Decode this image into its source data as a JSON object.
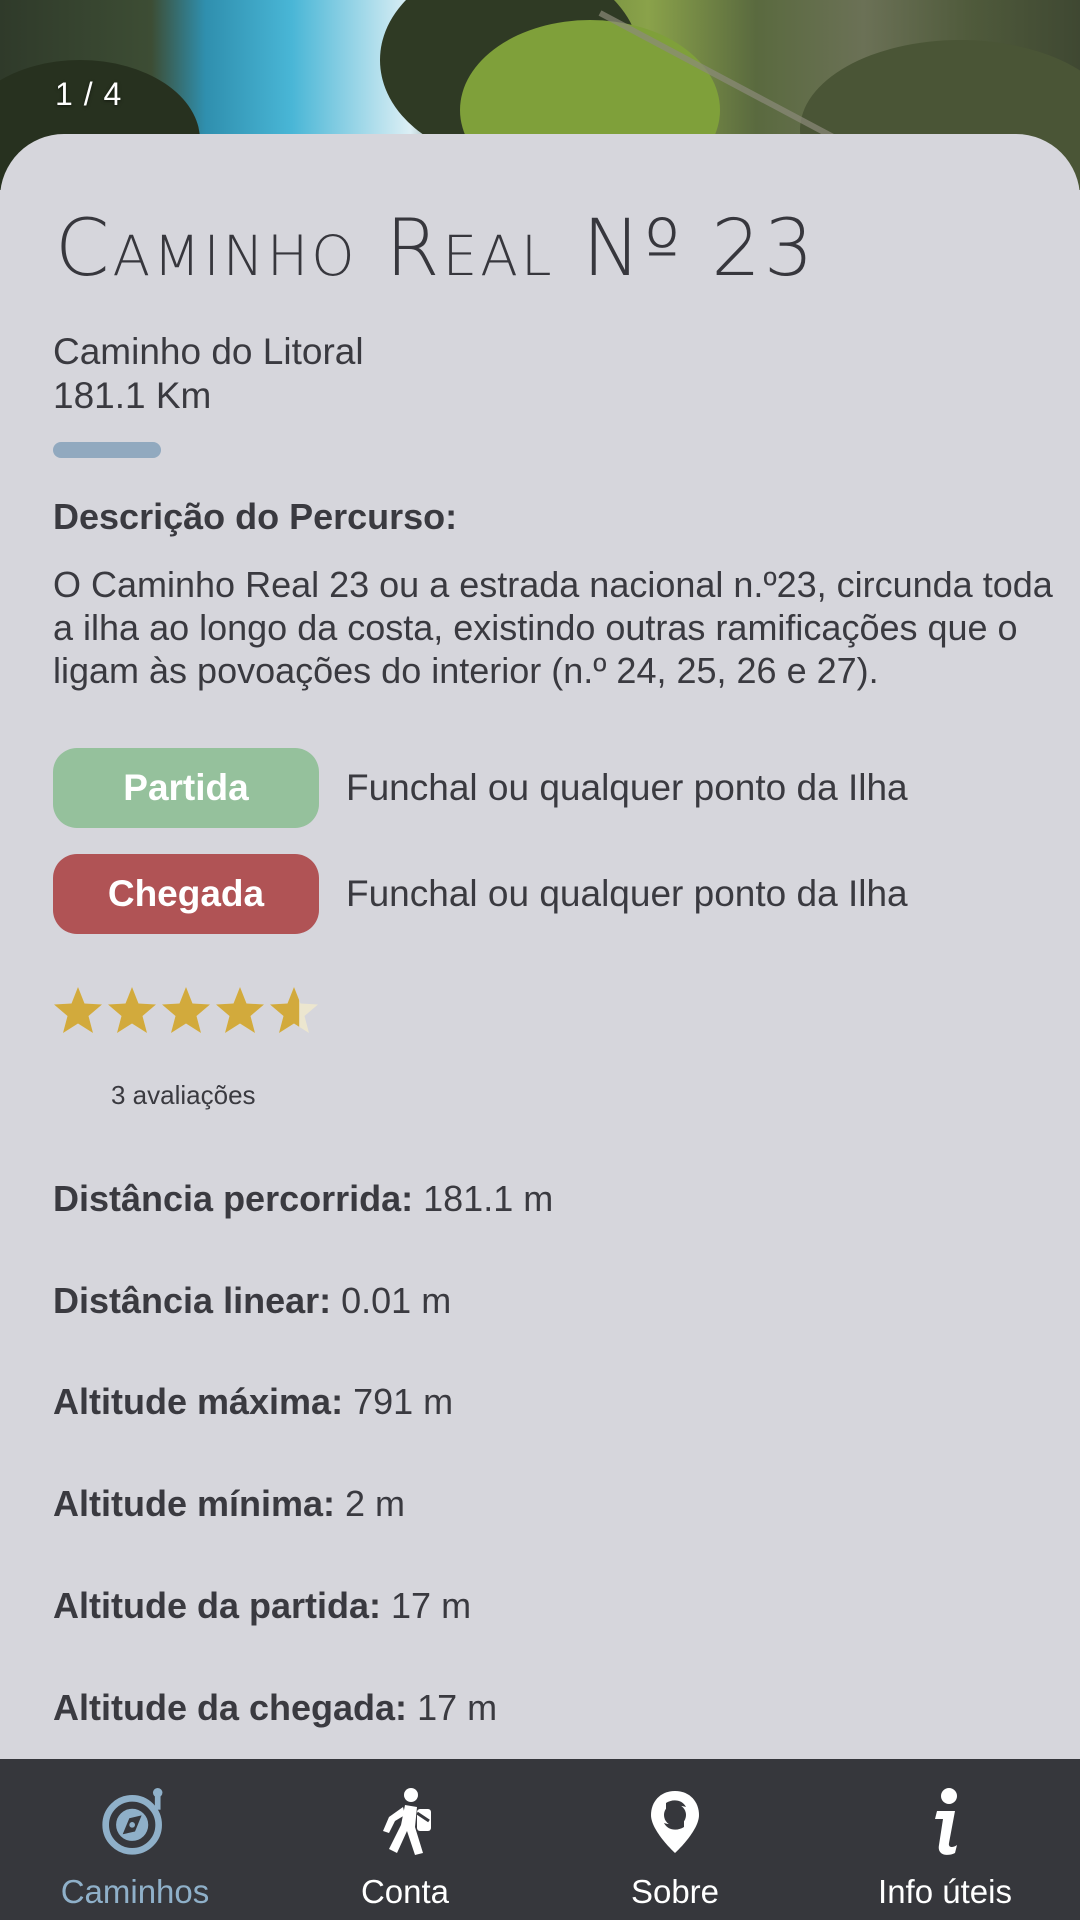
{
  "gallery": {
    "counter": "1 / 4"
  },
  "route": {
    "title": "Caminho Real Nº 23",
    "category": "Caminho do Litoral",
    "length": "181.1 Km"
  },
  "description": {
    "heading": "Descrição do Percurso:",
    "text": "O Caminho Real 23 ou a estrada nacional n.º23, circunda toda a ilha ao longo da costa, existindo outras ramificações que o ligam às povoações do interior (n.º 24, 25, 26 e 27)."
  },
  "start": {
    "label": "Partida",
    "location": "Funchal ou qualquer ponto da Ilha",
    "color": "#95c19c"
  },
  "end": {
    "label": "Chegada",
    "location": "Funchal ou qualquer ponto da Ilha",
    "color": "#b05355"
  },
  "rating": {
    "value": 4.6,
    "max": 5,
    "reviews_label": "3 avaliações",
    "star_color": "#d2aa3c"
  },
  "stats": [
    {
      "label": "Distância percorrida:",
      "value": "181.1 m"
    },
    {
      "label": "Distância linear:",
      "value": "0.01 m"
    },
    {
      "label": "Altitude máxima:",
      "value": "791 m"
    },
    {
      "label": "Altitude mínima:",
      "value": "2 m"
    },
    {
      "label": "Altitude da partida:",
      "value": "17 m"
    },
    {
      "label": "Altitude da chegada:",
      "value": "17 m"
    }
  ],
  "tabbar": {
    "active_color": "#8fb0c9",
    "items": [
      {
        "label": "Caminhos",
        "icon": "compass-icon",
        "active": true
      },
      {
        "label": "Conta",
        "icon": "hiker-icon",
        "active": false
      },
      {
        "label": "Sobre",
        "icon": "location-pin-icon",
        "active": false
      },
      {
        "label": "Info úteis",
        "icon": "info-icon",
        "active": false
      }
    ]
  }
}
